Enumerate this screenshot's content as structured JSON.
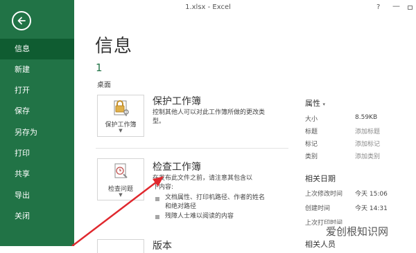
{
  "window": {
    "title": "1.xlsx - Excel",
    "help": "?",
    "minimize": "—"
  },
  "sidebar": {
    "items": [
      {
        "label": "信息"
      },
      {
        "label": "新建"
      },
      {
        "label": "打开"
      },
      {
        "label": "保存"
      },
      {
        "label": "另存为"
      },
      {
        "label": "打印"
      },
      {
        "label": "共享"
      },
      {
        "label": "导出"
      },
      {
        "label": "关闭"
      }
    ]
  },
  "main": {
    "title": "信息",
    "file_name": "1",
    "file_location": "桌面",
    "protect": {
      "button_label": "保护工作簿",
      "heading": "保护工作簿",
      "description": "控制其他人可以对此工作簿所做的更改类型。"
    },
    "inspect": {
      "button_label": "检查问题",
      "heading": "检查工作簿",
      "description": "在发布此文件之前，请注意其包含以下内容:",
      "bullets": [
        "文档属性、打印机路径、作者的姓名和绝对路径",
        "残障人士难以阅读的内容"
      ]
    },
    "versions_heading": "版本"
  },
  "properties": {
    "heading": "属性",
    "rows": [
      {
        "label": "大小",
        "value": "8.59KB"
      },
      {
        "label": "标题",
        "value": "添加标题"
      },
      {
        "label": "标记",
        "value": "添加标记"
      },
      {
        "label": "类别",
        "value": "添加类别"
      }
    ],
    "dates_heading": "相关日期",
    "dates": [
      {
        "label": "上次修改时间",
        "value": "今天 15:06"
      },
      {
        "label": "创建时间",
        "value": "今天 14:31"
      },
      {
        "label": "上次打印时间",
        "value": ""
      }
    ],
    "people_heading": "相关人员"
  },
  "watermark": "爱创根知识网",
  "colors": {
    "sidebar": "#217346",
    "sidebar_active": "#0f5c31",
    "arrow": "#e0282e"
  }
}
